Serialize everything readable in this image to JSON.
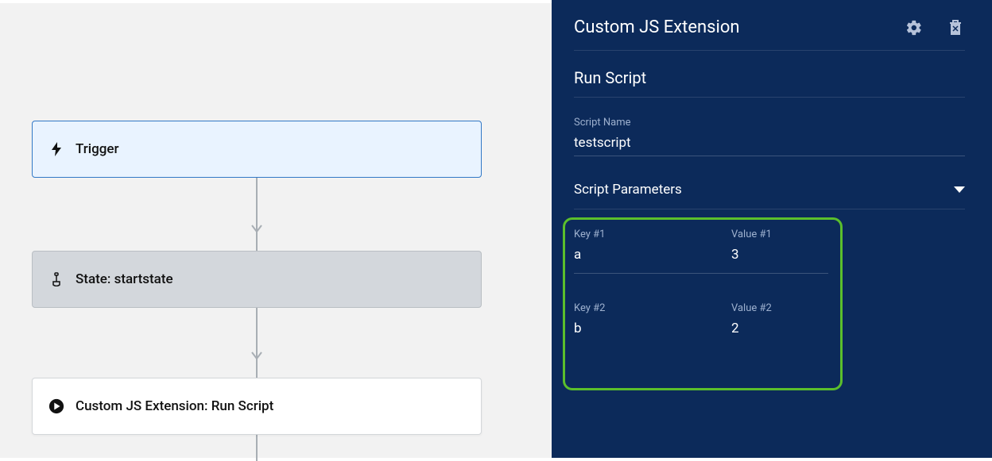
{
  "canvas": {
    "trigger_label": "Trigger",
    "state_label": "State: startstate",
    "custom_label": "Custom JS Extension: Run Script"
  },
  "panel": {
    "title": "Custom JS Extension",
    "subtitle": "Run Script",
    "script_name_label": "Script Name",
    "script_name_value": "testscript",
    "parameters_label": "Script Parameters",
    "params": [
      {
        "key_label": "Key #1",
        "key_value": "a",
        "value_label": "Value #1",
        "value_value": "3"
      },
      {
        "key_label": "Key #2",
        "key_value": "b",
        "value_label": "Value #2",
        "value_value": "2"
      }
    ]
  }
}
